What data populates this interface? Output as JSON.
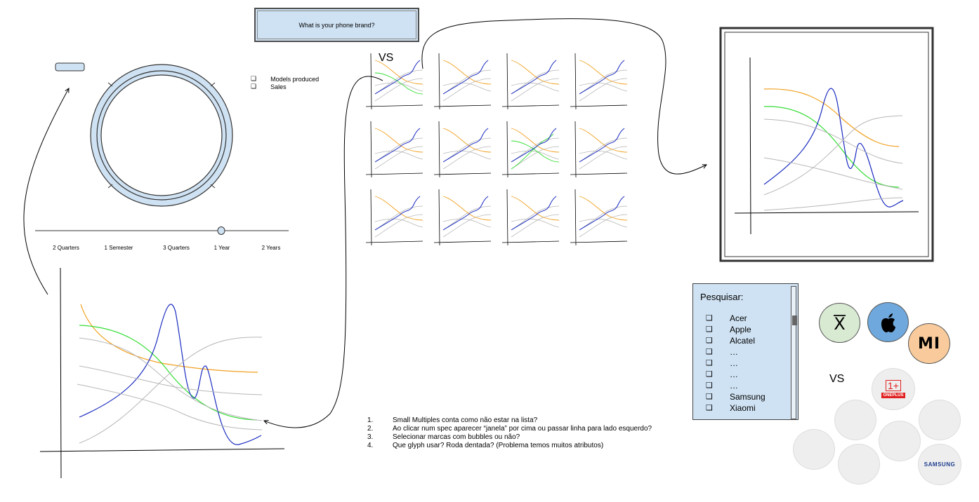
{
  "question_box": {
    "label": "What is your phone brand?"
  },
  "legend": {
    "items": [
      "Models produced",
      "Sales"
    ],
    "checkbox_glyph": "❑"
  },
  "timeline": {
    "ticks": [
      "2 Quarters",
      "1 Semester",
      "3 Quarters",
      "1 Year",
      "2 Years"
    ],
    "selected": "1 Year"
  },
  "small_multiples": {
    "rows": 3,
    "cols": 4,
    "vs_label": "VS"
  },
  "search_panel": {
    "title": "Pesquisar:",
    "brands": [
      "Acer",
      "Apple",
      "Alcatel",
      "…",
      "…",
      "…",
      "…",
      "Samsung",
      "Xiaomi"
    ]
  },
  "questions": [
    {
      "n": "1.",
      "text": "Small Multiples conta como não estar na lista?"
    },
    {
      "n": "2.",
      "text": "Ao clicar num spec aparecer “janela” por cima ou passar linha para lado esquerdo?"
    },
    {
      "n": "3.",
      "text": "Selecionar marcas com bubbles ou não?"
    },
    {
      "n": "4.",
      "text": "Que glyph usar? Roda dentada? (Problema temos muitos atributos)"
    }
  ],
  "brand_bubbles": {
    "vs_label": "VS",
    "xiaomi_x": "X",
    "mi": "MI",
    "oneplus_mark": "1+",
    "oneplus_text": "ONEPLUS",
    "samsung": "SAMSUNG"
  },
  "colors": {
    "accent_blue": "#cfe2f3",
    "line_orange": "#f0a020",
    "line_green": "#33dd33",
    "line_blue": "#1a2bc0",
    "line_gray": "#b7b7b7"
  }
}
